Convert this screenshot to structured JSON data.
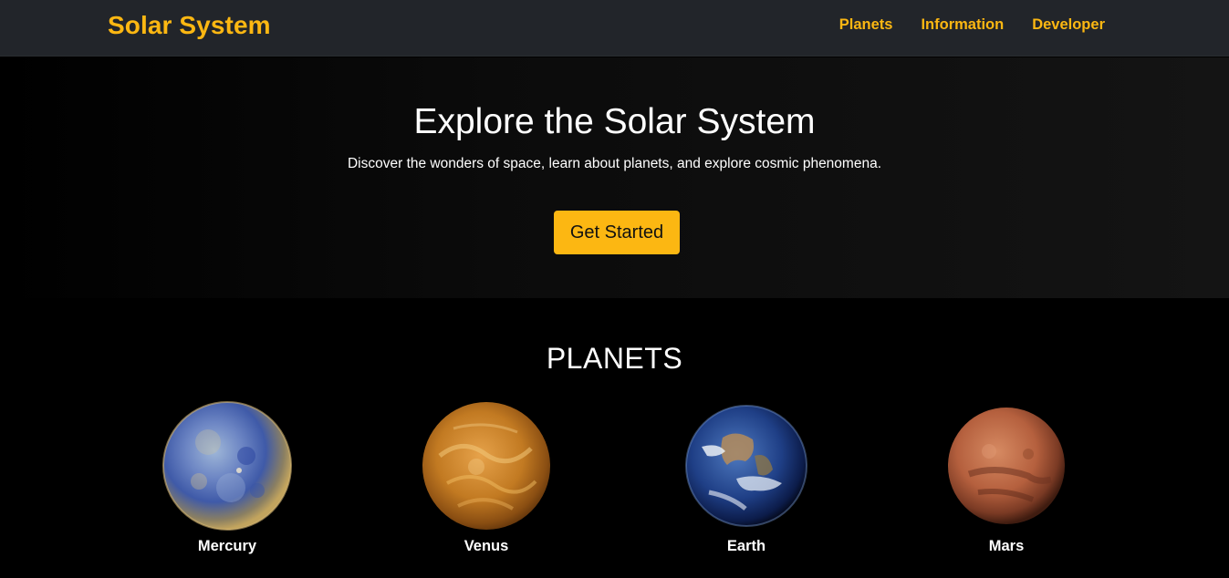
{
  "nav": {
    "brand": "Solar System",
    "links": [
      "Planets",
      "Information",
      "Developer"
    ]
  },
  "hero": {
    "title": "Explore the Solar System",
    "subtitle": "Discover the wonders of space, learn about planets, and explore cosmic phenomena.",
    "cta": "Get Started"
  },
  "planets": {
    "title": "PLANETS",
    "items": [
      {
        "name": "Mercury",
        "icon": "mercury-image"
      },
      {
        "name": "Venus",
        "icon": "venus-image"
      },
      {
        "name": "Earth",
        "icon": "earth-image"
      },
      {
        "name": "Mars",
        "icon": "mars-image"
      }
    ]
  },
  "colors": {
    "accent": "#fcb712",
    "navbar": "#22252a",
    "background": "#000000"
  }
}
